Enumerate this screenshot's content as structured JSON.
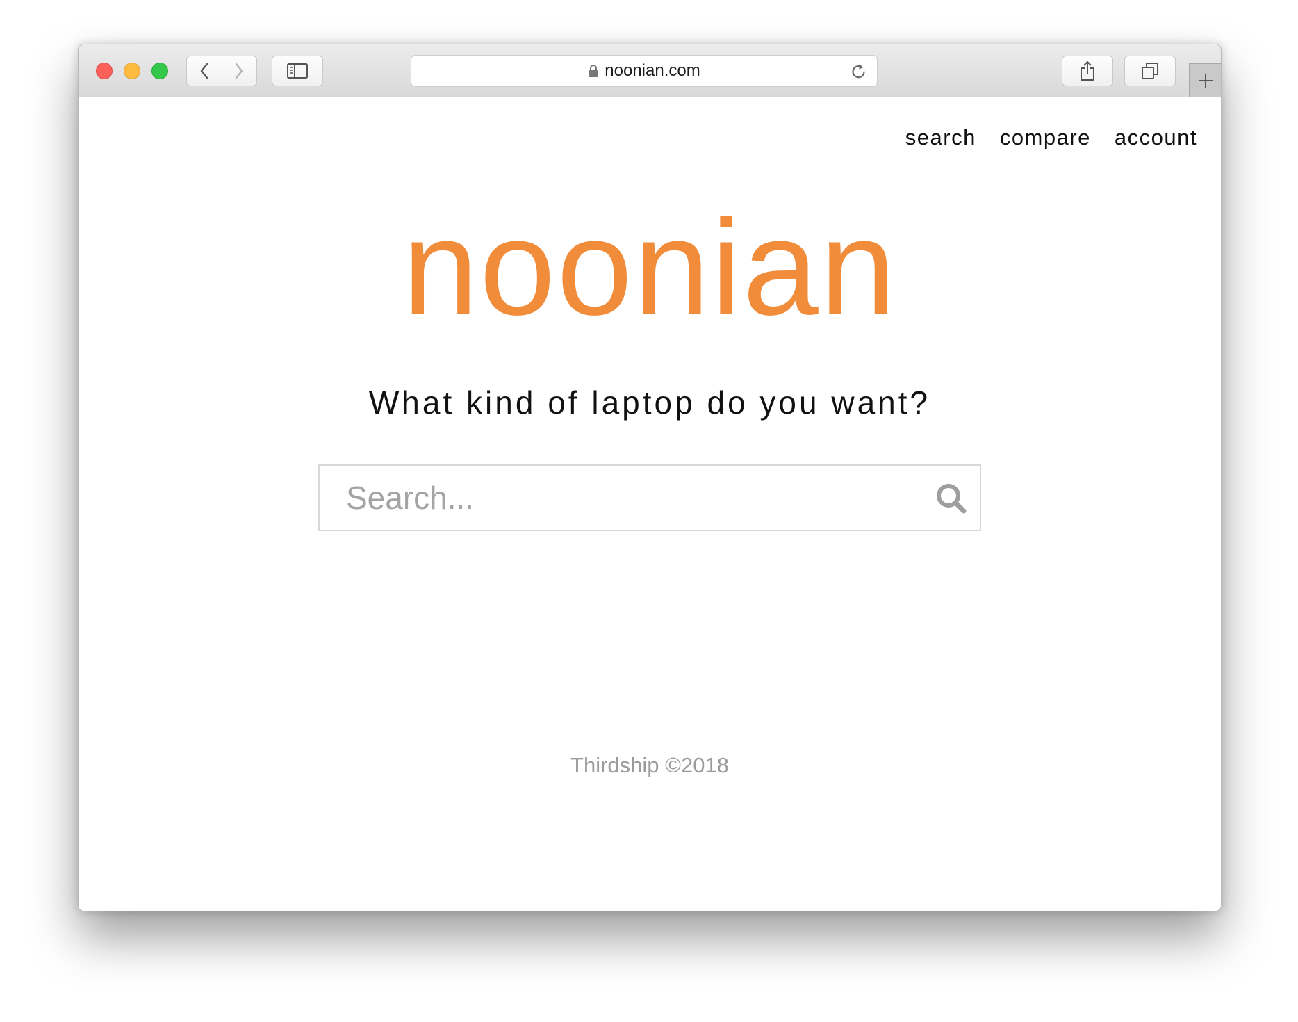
{
  "browser": {
    "url": "noonian.com",
    "icons": {
      "back": "chevron-left-icon",
      "forward": "chevron-right-icon",
      "sidebar": "sidebar-icon",
      "lock": "lock-icon",
      "reload": "reload-icon",
      "share": "share-icon",
      "tabs": "tabs-icon",
      "new_tab": "plus-icon"
    }
  },
  "nav": {
    "items": [
      {
        "label": "search"
      },
      {
        "label": "compare"
      },
      {
        "label": "account"
      }
    ]
  },
  "hero": {
    "logo": "noonian",
    "tagline": "What kind of laptop do you want?"
  },
  "search": {
    "placeholder": "Search...",
    "value": ""
  },
  "footer": {
    "text": "Thirdship ©2018"
  },
  "colors": {
    "brand": "#f08c3a",
    "text": "#111111",
    "muted": "#9b9b9b",
    "close": "#fc605b",
    "minimize": "#fdbc40",
    "maximize": "#34c84a"
  }
}
